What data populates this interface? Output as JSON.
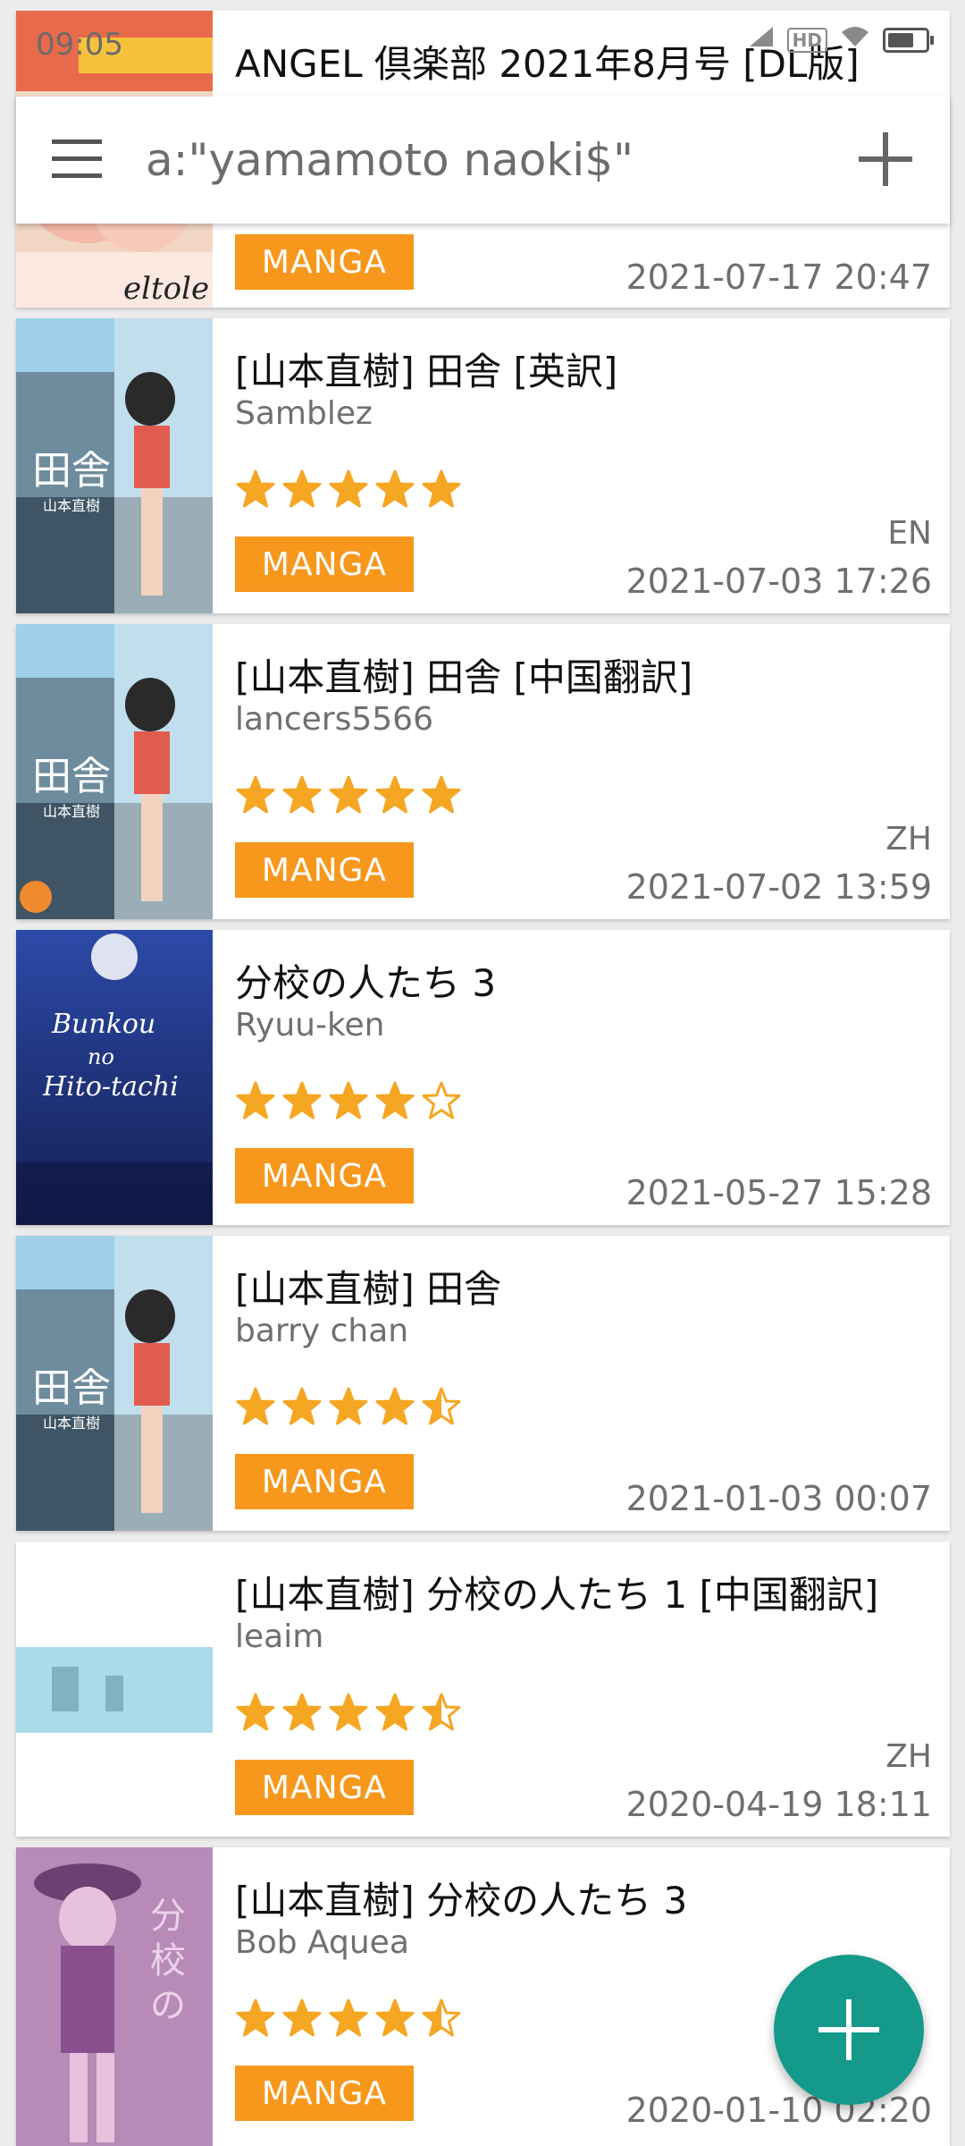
{
  "status_bar": {
    "time": "09:05",
    "hd": "HD"
  },
  "search": {
    "query": "a:\"yamamoto naoki$\""
  },
  "colors": {
    "badge": "#f7981d",
    "star": "#f5a623",
    "fab": "#14998a"
  },
  "items": [
    {
      "title": "ANGEL 倶楽部 2021年8月号 [DL版]",
      "uploader": "",
      "rating": null,
      "category": "MANGA",
      "language": "",
      "date": "2021-07-17 20:47"
    },
    {
      "title": "[山本直樹] 田舎 [英訳]",
      "uploader": "Samblez",
      "rating": 5,
      "category": "MANGA",
      "language": "EN",
      "date": "2021-07-03 17:26"
    },
    {
      "title": "[山本直樹] 田舎 [中国翻訳]",
      "uploader": "lancers5566",
      "rating": 5,
      "category": "MANGA",
      "language": "ZH",
      "date": "2021-07-02 13:59"
    },
    {
      "title": "分校の人たち 3",
      "uploader": "Ryuu-ken",
      "rating": 4,
      "category": "MANGA",
      "language": "",
      "date": "2021-05-27 15:28"
    },
    {
      "title": "[山本直樹] 田舎",
      "uploader": "barry chan",
      "rating": 4.5,
      "category": "MANGA",
      "language": "",
      "date": "2021-01-03 00:07"
    },
    {
      "title": "[山本直樹] 分校の人たち 1 [中国翻訳]",
      "uploader": "leaim",
      "rating": 4.5,
      "category": "MANGA",
      "language": "ZH",
      "date": "2020-04-19 18:11"
    },
    {
      "title": "[山本直樹] 分校の人たち 3",
      "uploader": "Bob Aquea",
      "rating": 4.5,
      "category": "MANGA",
      "language": "",
      "date": "2020-01-10 02:20"
    }
  ]
}
